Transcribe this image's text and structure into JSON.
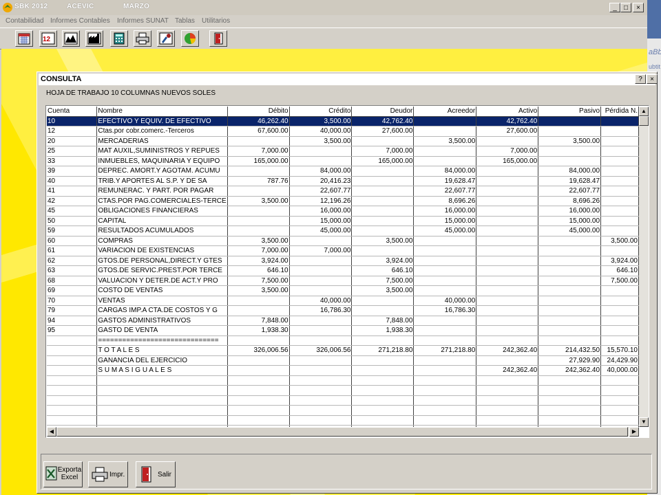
{
  "titlebar": {
    "app": "SBK 2012",
    "company": "ACEVIC",
    "period": "MARZO"
  },
  "menu": [
    "Contabilidad",
    "Informes Contables",
    "Informes SUNAT",
    "Tablas",
    "Utilitarios"
  ],
  "toolbar": {
    "icons": [
      "calendar-icon",
      "numbers-icon",
      "chart-icon",
      "factory-icon",
      "calculator-icon",
      "printer-icon",
      "tools-icon",
      "pie-chart-icon",
      "exit-door-icon"
    ]
  },
  "side_text": {
    "t1": "aBb",
    "t2": "ubtit"
  },
  "dialog": {
    "title": "CONSULTA",
    "help": "?",
    "close": "×",
    "subtitle": "HOJA DE TRABAJO 10 COLUMNAS NUEVOS SOLES",
    "columns": [
      "Cuenta",
      "Nombre",
      "Débito",
      "Crédito",
      "Deudor",
      "Acreedor",
      "Activo",
      "Pasivo",
      "Pérdida N."
    ],
    "rows": [
      [
        "10",
        "EFECTIVO Y EQUIV. DE EFECTIVO",
        "46,262.40",
        "3,500.00",
        "42,762.40",
        "",
        "42,762.40",
        "",
        ""
      ],
      [
        "12",
        "Ctas.por cobr.comerc.-Terceros",
        "67,600.00",
        "40,000.00",
        "27,600.00",
        "",
        "27,600.00",
        "",
        ""
      ],
      [
        "20",
        "MERCADERIAS",
        "",
        "3,500.00",
        "",
        "3,500.00",
        "",
        "3,500.00",
        ""
      ],
      [
        "25",
        "MAT AUXIL,SUMINISTROS Y REPUES",
        "7,000.00",
        "",
        "7,000.00",
        "",
        "7,000.00",
        "",
        ""
      ],
      [
        "33",
        "INMUEBLES, MAQUINARIA Y EQUIPO",
        "165,000.00",
        "",
        "165,000.00",
        "",
        "165,000.00",
        "",
        ""
      ],
      [
        "39",
        "DEPREC. AMORT.Y AGOTAM. ACUMU",
        "",
        "84,000.00",
        "",
        "84,000.00",
        "",
        "84,000.00",
        ""
      ],
      [
        "40",
        "TRIB.Y APORTES AL S.P. Y DE SA",
        "787.76",
        "20,416.23",
        "",
        "19,628.47",
        "",
        "19,628.47",
        ""
      ],
      [
        "41",
        "REMUNERAC. Y PART. POR PAGAR",
        "",
        "22,607.77",
        "",
        "22,607.77",
        "",
        "22,607.77",
        ""
      ],
      [
        "42",
        "CTAS.POR PAG.COMERCIALES-TERCE",
        "3,500.00",
        "12,196.26",
        "",
        "8,696.26",
        "",
        "8,696.26",
        ""
      ],
      [
        "45",
        "OBLIGACIONES FINANCIERAS",
        "",
        "16,000.00",
        "",
        "16,000.00",
        "",
        "16,000.00",
        ""
      ],
      [
        "50",
        "CAPITAL",
        "",
        "15,000.00",
        "",
        "15,000.00",
        "",
        "15,000.00",
        ""
      ],
      [
        "59",
        "RESULTADOS ACUMULADOS",
        "",
        "45,000.00",
        "",
        "45,000.00",
        "",
        "45,000.00",
        ""
      ],
      [
        "60",
        "COMPRAS",
        "3,500.00",
        "",
        "3,500.00",
        "",
        "",
        "",
        "3,500.00"
      ],
      [
        "61",
        "VARIACION DE EXISTENCIAS",
        "7,000.00",
        "7,000.00",
        "",
        "",
        "",
        "",
        ""
      ],
      [
        "62",
        "GTOS.DE PERSONAL,DIRECT.Y GTES",
        "3,924.00",
        "",
        "3,924.00",
        "",
        "",
        "",
        "3,924.00"
      ],
      [
        "63",
        "GTOS.DE SERVIC.PREST.POR TERCE",
        "646.10",
        "",
        "646.10",
        "",
        "",
        "",
        "646.10"
      ],
      [
        "68",
        "VALUACION Y DETER.DE ACT.Y PRO",
        "7,500.00",
        "",
        "7,500.00",
        "",
        "",
        "",
        "7,500.00"
      ],
      [
        "69",
        "COSTO DE VENTAS",
        "3,500.00",
        "",
        "3,500.00",
        "",
        "",
        "",
        ""
      ],
      [
        "70",
        "VENTAS",
        "",
        "40,000.00",
        "",
        "40,000.00",
        "",
        "",
        ""
      ],
      [
        "79",
        "CARGAS IMP.A CTA.DE COSTOS Y G",
        "",
        "16,786.30",
        "",
        "16,786.30",
        "",
        "",
        ""
      ],
      [
        "94",
        "GASTOS ADMINISTRATIVOS",
        "7,848.00",
        "",
        "7,848.00",
        "",
        "",
        "",
        ""
      ],
      [
        "95",
        "GASTO DE VENTA",
        "1,938.30",
        "",
        "1,938.30",
        "",
        "",
        "",
        ""
      ],
      [
        "",
        "==============================",
        "",
        "",
        "",
        "",
        "",
        "",
        ""
      ],
      [
        "",
        "T O T A L E S",
        "326,006.56",
        "326,006.56",
        "271,218.80",
        "271,218.80",
        "242,362.40",
        "214,432.50",
        "15,570.10"
      ],
      [
        "",
        "GANANCIA DEL EJERCICIO",
        "",
        "",
        "",
        "",
        "",
        "27,929.90",
        "24,429.90"
      ],
      [
        "",
        "S U M A S   I G U A L E S",
        "",
        "",
        "",
        "",
        "242,362.40",
        "242,362.40",
        "40,000.00"
      ]
    ],
    "empty_rows": 8,
    "selected_row": 0,
    "buttons": {
      "export": "Exporta Excel",
      "print": "Impr.",
      "exit": "Salir"
    }
  }
}
